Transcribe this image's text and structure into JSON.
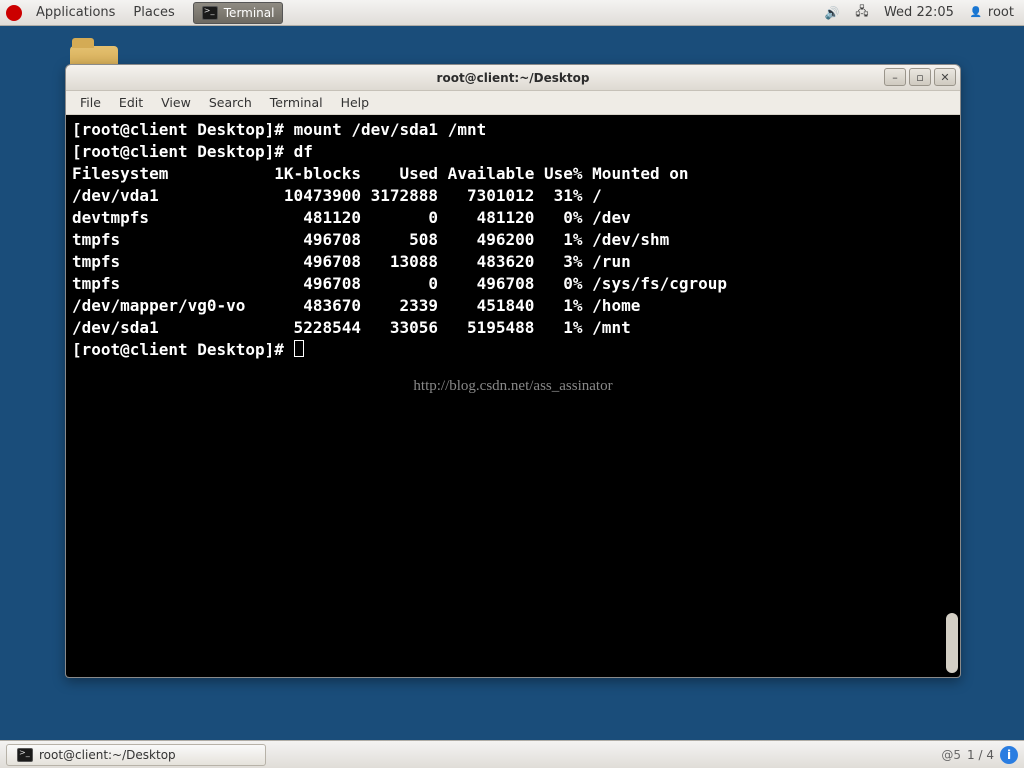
{
  "top_panel": {
    "applications": "Applications",
    "places": "Places",
    "task_label": "Terminal",
    "clock": "Wed 22:05",
    "user": "root"
  },
  "window": {
    "title": "root@client:~/Desktop",
    "menu": {
      "file": "File",
      "edit": "Edit",
      "view": "View",
      "search": "Search",
      "terminal": "Terminal",
      "help": "Help"
    }
  },
  "terminal": {
    "prompt": "[root@client Desktop]#",
    "cmd_mount": "mount /dev/sda1 /mnt",
    "cmd_df": "df",
    "header": "Filesystem           1K-blocks    Used Available Use% Mounted on",
    "rows": [
      "/dev/vda1             10473900 3172888   7301012  31% /",
      "devtmpfs                481120       0    481120   0% /dev",
      "tmpfs                   496708     508    496200   1% /dev/shm",
      "tmpfs                   496708   13088    483620   3% /run",
      "tmpfs                   496708       0    496708   0% /sys/fs/cgroup",
      "/dev/mapper/vg0-vo      483670    2339    451840   1% /home",
      "/dev/sda1              5228544   33056   5195488   1% /mnt"
    ],
    "watermark": "http://blog.csdn.net/ass_assinator"
  },
  "bottom_panel": {
    "task_label": "root@client:~/Desktop",
    "pager": "1 / 4",
    "watermark_prefix": "@5"
  }
}
